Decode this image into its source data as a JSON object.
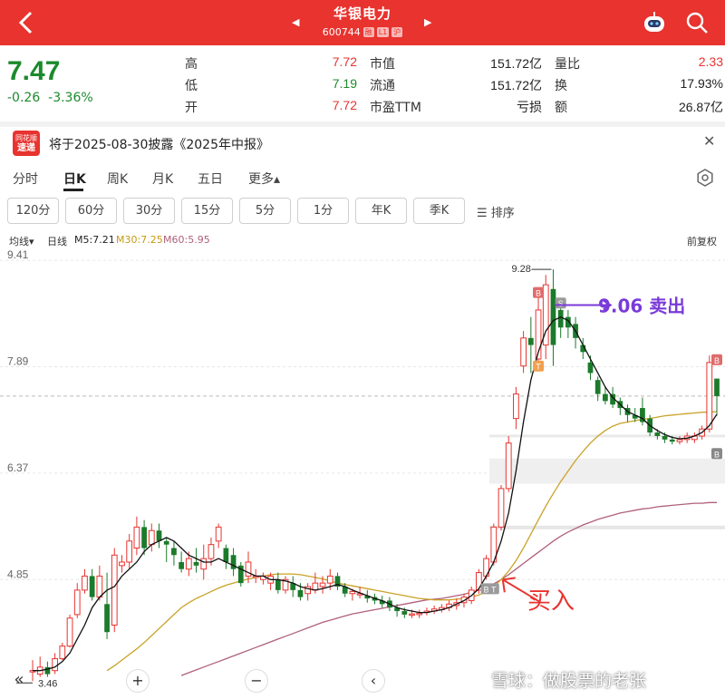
{
  "header": {
    "back_icon": "chevron-left-icon",
    "stock_name": "华银电力",
    "stock_code": "600744",
    "tags": [
      "融",
      "L1",
      "沪"
    ],
    "bot_icon": "robot-icon",
    "search_icon": "search-icon",
    "accent": "#e8332f"
  },
  "quote": {
    "price": "7.47",
    "change": "-0.26",
    "change_pct": "-3.36%",
    "rows": [
      {
        "k1": "高",
        "v1": "7.72",
        "k2": "市值",
        "v2": "151.72亿",
        "k3": "量比",
        "v3": "2.33"
      },
      {
        "k1": "低",
        "v1": "7.19",
        "k2": "流通",
        "v2": "151.72亿",
        "k3": "换",
        "v3": "17.93%"
      },
      {
        "k1": "开",
        "v1": "7.72",
        "k2": "市盈TTM",
        "v2": "亏损",
        "k3": "额",
        "v3": "26.87亿"
      }
    ]
  },
  "notice": {
    "logo_line1": "同花顺",
    "logo_line2": "速递",
    "text": "将于2025-08-30披露《2025年中报》",
    "close_icon": "close-icon"
  },
  "tabs": [
    "分时",
    "日K",
    "周K",
    "月K",
    "五日",
    "更多▴"
  ],
  "subtabs": [
    "120分",
    "60分",
    "30分",
    "15分",
    "5分",
    "1分",
    "年K",
    "季K"
  ],
  "sort_label": "排序",
  "legend": {
    "indicator": "均线▾",
    "period": "日线",
    "ma5": "M5:7.21",
    "ma30": "M30:7.25",
    "ma60": "M60:5.95",
    "adjust": "前复权"
  },
  "chart_data": {
    "type": "candlestick",
    "y_axis_labels": [
      "9.41",
      "7.89",
      "6.37",
      "4.85"
    ],
    "ylim": [
      3.3,
      9.45
    ],
    "current_price_line": 7.47,
    "high_marker": "9.28",
    "low_marker": "3.46",
    "annotations": {
      "sell_note": "9.06 卖出",
      "buy_note": "买入",
      "markers": [
        "B",
        "S",
        "T",
        "B",
        "T",
        "B",
        "B"
      ]
    },
    "candles": [
      {
        "o": 3.55,
        "c": 3.55,
        "h": 3.7,
        "l": 3.4
      },
      {
        "o": 3.5,
        "c": 3.6,
        "h": 3.75,
        "l": 3.46
      },
      {
        "o": 3.6,
        "c": 3.5,
        "h": 3.68,
        "l": 3.46
      },
      {
        "o": 3.55,
        "c": 3.72,
        "h": 3.8,
        "l": 3.5
      },
      {
        "o": 3.72,
        "c": 3.9,
        "h": 3.95,
        "l": 3.7
      },
      {
        "o": 3.9,
        "c": 4.3,
        "h": 4.35,
        "l": 3.88
      },
      {
        "o": 4.35,
        "c": 4.7,
        "h": 4.8,
        "l": 4.3
      },
      {
        "o": 4.7,
        "c": 4.9,
        "h": 5.0,
        "l": 4.65
      },
      {
        "o": 4.9,
        "c": 4.6,
        "h": 5.0,
        "l": 4.55
      },
      {
        "o": 4.6,
        "c": 4.9,
        "h": 5.05,
        "l": 4.55
      },
      {
        "o": 4.5,
        "c": 4.1,
        "h": 4.95,
        "l": 4.0
      },
      {
        "o": 4.2,
        "c": 5.2,
        "h": 5.3,
        "l": 4.1
      },
      {
        "o": 5.05,
        "c": 5.1,
        "h": 5.2,
        "l": 4.95
      },
      {
        "o": 5.1,
        "c": 5.4,
        "h": 5.5,
        "l": 5.0
      },
      {
        "o": 5.3,
        "c": 5.6,
        "h": 5.75,
        "l": 5.2
      },
      {
        "o": 5.6,
        "c": 5.3,
        "h": 5.7,
        "l": 5.2
      },
      {
        "o": 5.35,
        "c": 5.55,
        "h": 5.65,
        "l": 5.25
      },
      {
        "o": 5.55,
        "c": 5.4,
        "h": 5.65,
        "l": 5.3
      },
      {
        "o": 5.4,
        "c": 5.35,
        "h": 5.45,
        "l": 5.1
      },
      {
        "o": 5.3,
        "c": 5.2,
        "h": 5.4,
        "l": 5.05
      },
      {
        "o": 5.1,
        "c": 5.0,
        "h": 5.25,
        "l": 4.95
      },
      {
        "o": 5.0,
        "c": 5.15,
        "h": 5.25,
        "l": 4.9
      },
      {
        "o": 5.1,
        "c": 5.05,
        "h": 5.3,
        "l": 4.95
      },
      {
        "o": 5.0,
        "c": 5.15,
        "h": 5.35,
        "l": 4.85
      },
      {
        "o": 5.15,
        "c": 5.35,
        "h": 5.45,
        "l": 5.05
      },
      {
        "o": 5.4,
        "c": 5.6,
        "h": 5.65,
        "l": 5.3
      },
      {
        "o": 5.3,
        "c": 5.1,
        "h": 5.35,
        "l": 5.0
      },
      {
        "o": 5.2,
        "c": 5.0,
        "h": 5.3,
        "l": 4.9
      },
      {
        "o": 5.05,
        "c": 4.8,
        "h": 5.1,
        "l": 4.75
      },
      {
        "o": 4.9,
        "c": 5.1,
        "h": 5.25,
        "l": 4.8
      },
      {
        "o": 4.9,
        "c": 4.9,
        "h": 5.0,
        "l": 4.8
      },
      {
        "o": 4.85,
        "c": 4.9,
        "h": 4.95,
        "l": 4.78
      },
      {
        "o": 4.8,
        "c": 4.9,
        "h": 4.95,
        "l": 4.7
      },
      {
        "o": 4.85,
        "c": 4.7,
        "h": 4.95,
        "l": 4.65
      },
      {
        "o": 4.7,
        "c": 4.85,
        "h": 4.9,
        "l": 4.65
      },
      {
        "o": 4.8,
        "c": 4.7,
        "h": 4.9,
        "l": 4.6
      },
      {
        "o": 4.7,
        "c": 4.6,
        "h": 4.8,
        "l": 4.55
      },
      {
        "o": 4.65,
        "c": 4.75,
        "h": 4.8,
        "l": 4.55
      },
      {
        "o": 4.7,
        "c": 4.8,
        "h": 4.95,
        "l": 4.65
      },
      {
        "o": 4.75,
        "c": 4.8,
        "h": 4.9,
        "l": 4.65
      },
      {
        "o": 4.8,
        "c": 4.9,
        "h": 5.0,
        "l": 4.7
      },
      {
        "o": 4.9,
        "c": 4.75,
        "h": 4.95,
        "l": 4.7
      },
      {
        "o": 4.75,
        "c": 4.65,
        "h": 4.8,
        "l": 4.6
      },
      {
        "o": 4.65,
        "c": 4.68,
        "h": 4.72,
        "l": 4.55
      },
      {
        "o": 4.65,
        "c": 4.65,
        "h": 4.75,
        "l": 4.58
      },
      {
        "o": 4.62,
        "c": 4.58,
        "h": 4.7,
        "l": 4.52
      },
      {
        "o": 4.6,
        "c": 4.55,
        "h": 4.65,
        "l": 4.5
      },
      {
        "o": 4.55,
        "c": 4.5,
        "h": 4.62,
        "l": 4.45
      },
      {
        "o": 4.55,
        "c": 4.45,
        "h": 4.6,
        "l": 4.4
      },
      {
        "o": 4.45,
        "c": 4.4,
        "h": 4.5,
        "l": 4.32
      },
      {
        "o": 4.4,
        "c": 4.35,
        "h": 4.45,
        "l": 4.3
      },
      {
        "o": 4.35,
        "c": 4.36,
        "h": 4.42,
        "l": 4.3
      },
      {
        "o": 4.35,
        "c": 4.37,
        "h": 4.42,
        "l": 4.3
      },
      {
        "o": 4.38,
        "c": 4.4,
        "h": 4.45,
        "l": 4.34
      },
      {
        "o": 4.4,
        "c": 4.43,
        "h": 4.48,
        "l": 4.36
      },
      {
        "o": 4.42,
        "c": 4.45,
        "h": 4.5,
        "l": 4.38
      },
      {
        "o": 4.45,
        "c": 4.5,
        "h": 4.55,
        "l": 4.4
      },
      {
        "o": 4.48,
        "c": 4.52,
        "h": 4.58,
        "l": 4.42
      },
      {
        "o": 4.52,
        "c": 4.6,
        "h": 4.65,
        "l": 4.45
      },
      {
        "o": 4.55,
        "c": 4.7,
        "h": 4.75,
        "l": 4.5
      },
      {
        "o": 4.7,
        "c": 4.95,
        "h": 5.0,
        "l": 4.65
      },
      {
        "o": 4.9,
        "c": 5.15,
        "h": 5.2,
        "l": 4.85
      },
      {
        "o": 5.1,
        "c": 5.6,
        "h": 5.65,
        "l": 5.05
      },
      {
        "o": 5.6,
        "c": 6.15,
        "h": 6.2,
        "l": 5.55
      },
      {
        "o": 6.15,
        "c": 6.8,
        "h": 6.9,
        "l": 6.1
      },
      {
        "o": 7.15,
        "c": 7.5,
        "h": 7.6,
        "l": 7.0
      },
      {
        "o": 7.9,
        "c": 8.3,
        "h": 8.4,
        "l": 7.8
      },
      {
        "o": 8.3,
        "c": 8.2,
        "h": 8.6,
        "l": 7.8
      },
      {
        "o": 8.0,
        "c": 8.7,
        "h": 8.9,
        "l": 7.9
      },
      {
        "o": 8.2,
        "c": 9.06,
        "h": 9.2,
        "l": 8.0
      },
      {
        "o": 9.0,
        "c": 8.2,
        "h": 9.28,
        "l": 7.9
      },
      {
        "o": 8.7,
        "c": 8.45,
        "h": 8.85,
        "l": 8.3
      },
      {
        "o": 8.6,
        "c": 8.45,
        "h": 8.7,
        "l": 8.3
      },
      {
        "o": 8.5,
        "c": 8.3,
        "h": 8.6,
        "l": 8.15
      },
      {
        "o": 8.2,
        "c": 8.1,
        "h": 8.3,
        "l": 8.0
      },
      {
        "o": 7.95,
        "c": 7.8,
        "h": 8.05,
        "l": 7.7
      },
      {
        "o": 7.7,
        "c": 7.5,
        "h": 7.75,
        "l": 7.4
      },
      {
        "o": 7.5,
        "c": 7.4,
        "h": 7.6,
        "l": 7.35
      },
      {
        "o": 7.5,
        "c": 7.35,
        "h": 7.6,
        "l": 7.3
      },
      {
        "o": 7.4,
        "c": 7.3,
        "h": 7.45,
        "l": 7.2
      },
      {
        "o": 7.3,
        "c": 7.2,
        "h": 7.35,
        "l": 7.1
      },
      {
        "o": 7.2,
        "c": 7.15,
        "h": 7.3,
        "l": 7.1
      },
      {
        "o": 7.3,
        "c": 7.1,
        "h": 7.45,
        "l": 7.05
      },
      {
        "o": 7.15,
        "c": 6.95,
        "h": 7.2,
        "l": 6.9
      },
      {
        "o": 6.95,
        "c": 6.9,
        "h": 7.0,
        "l": 6.85
      },
      {
        "o": 6.9,
        "c": 6.85,
        "h": 6.95,
        "l": 6.8
      },
      {
        "o": 6.85,
        "c": 6.82,
        "h": 6.9,
        "l": 6.78
      },
      {
        "o": 6.82,
        "c": 6.85,
        "h": 6.9,
        "l": 6.78
      },
      {
        "o": 6.85,
        "c": 6.9,
        "h": 6.95,
        "l": 6.8
      },
      {
        "o": 6.85,
        "c": 6.9,
        "h": 6.95,
        "l": 6.8
      },
      {
        "o": 6.9,
        "c": 7.0,
        "h": 7.05,
        "l": 6.85
      },
      {
        "o": 7.0,
        "c": 7.95,
        "h": 8.05,
        "l": 6.95
      },
      {
        "o": 7.72,
        "c": 7.47,
        "h": 7.72,
        "l": 7.19
      }
    ],
    "ma5": [
      3.55,
      3.55,
      3.57,
      3.6,
      3.68,
      3.8,
      4.0,
      4.2,
      4.45,
      4.6,
      4.7,
      4.75,
      4.9,
      5.0,
      5.1,
      5.25,
      5.35,
      5.4,
      5.45,
      5.4,
      5.3,
      5.2,
      5.15,
      5.1,
      5.1,
      5.15,
      5.1,
      5.05,
      5.0,
      4.95,
      4.9,
      4.9,
      4.85,
      4.85,
      4.83,
      4.8,
      4.75,
      4.72,
      4.7,
      4.72,
      4.75,
      4.78,
      4.75,
      4.7,
      4.66,
      4.62,
      4.58,
      4.55,
      4.5,
      4.45,
      4.42,
      4.4,
      4.38,
      4.38,
      4.4,
      4.42,
      4.45,
      4.5,
      4.55,
      4.62,
      4.72,
      4.9,
      5.1,
      5.4,
      5.8,
      6.4,
      7.1,
      7.7,
      8.1,
      8.4,
      8.55,
      8.6,
      8.55,
      8.4,
      8.2,
      8.0,
      7.8,
      7.6,
      7.45,
      7.35,
      7.25,
      7.2,
      7.15,
      7.05,
      6.98,
      6.92,
      6.88,
      6.86,
      6.87,
      6.9,
      6.95,
      7.05,
      7.21
    ],
    "ma30": [
      null,
      null,
      null,
      null,
      null,
      null,
      null,
      null,
      null,
      null,
      3.55,
      3.62,
      3.7,
      3.78,
      3.86,
      3.95,
      4.05,
      4.15,
      4.25,
      4.35,
      4.45,
      4.52,
      4.58,
      4.63,
      4.68,
      4.73,
      4.77,
      4.8,
      4.83,
      4.86,
      4.88,
      4.9,
      4.92,
      4.93,
      4.93,
      4.93,
      4.92,
      4.9,
      4.88,
      4.86,
      4.83,
      4.8,
      4.78,
      4.76,
      4.74,
      4.72,
      4.7,
      4.68,
      4.66,
      4.64,
      4.62,
      4.6,
      4.58,
      4.57,
      4.56,
      4.56,
      4.56,
      4.57,
      4.58,
      4.6,
      4.63,
      4.68,
      4.75,
      4.85,
      4.97,
      5.12,
      5.3,
      5.5,
      5.7,
      5.9,
      6.08,
      6.25,
      6.4,
      6.55,
      6.68,
      6.8,
      6.9,
      6.98,
      7.04,
      7.08,
      7.1,
      7.12,
      7.14,
      7.15,
      7.17,
      7.19,
      7.2,
      7.21,
      7.22,
      7.23,
      7.24,
      7.24,
      7.25
    ],
    "ma60": [
      null,
      null,
      null,
      null,
      null,
      null,
      null,
      null,
      null,
      null,
      null,
      null,
      null,
      null,
      null,
      null,
      null,
      null,
      null,
      null,
      3.48,
      3.52,
      3.56,
      3.6,
      3.64,
      3.68,
      3.72,
      3.76,
      3.8,
      3.84,
      3.88,
      3.92,
      3.96,
      4.0,
      4.04,
      4.08,
      4.12,
      4.16,
      4.2,
      4.24,
      4.27,
      4.3,
      4.33,
      4.36,
      4.38,
      4.4,
      4.42,
      4.44,
      4.46,
      4.48,
      4.5,
      4.52,
      4.54,
      4.56,
      4.57,
      4.58,
      4.6,
      4.62,
      4.64,
      4.67,
      4.7,
      4.74,
      4.79,
      4.85,
      4.92,
      5.0,
      5.08,
      5.16,
      5.24,
      5.32,
      5.4,
      5.47,
      5.53,
      5.58,
      5.63,
      5.67,
      5.71,
      5.74,
      5.77,
      5.8,
      5.82,
      5.84,
      5.86,
      5.87,
      5.89,
      5.9,
      5.91,
      5.92,
      5.93,
      5.94,
      5.94,
      5.95,
      5.95
    ]
  },
  "controls": {
    "collapse_icon": "double-chevron-left-icon",
    "zoom_in_icon": "plus-icon",
    "zoom_out_icon": "minus-icon",
    "prev_icon": "chevron-left-icon",
    "watermark": "雪球：做股票的老张"
  }
}
